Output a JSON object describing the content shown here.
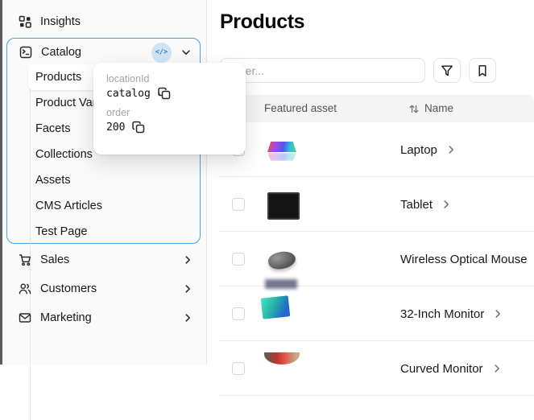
{
  "colors": {
    "accent_blue": "#4aa0e2",
    "badge_bg": "#cfe4f7",
    "badge_fg": "#2e77b6",
    "table_header_bg": "#f4f4f5"
  },
  "sidebar": {
    "insights": {
      "label": "Insights",
      "icon": "dashboard-icon"
    },
    "catalog": {
      "label": "Catalog",
      "icon": "terminal-square-icon",
      "badge_icon": "code-icon",
      "badge_text": "</>",
      "children": [
        "Products",
        "Product Variants",
        "Facets",
        "Collections",
        "Assets",
        "CMS Articles",
        "Test Page"
      ],
      "active_child": "Products"
    },
    "sales": {
      "label": "Sales",
      "icon": "cart-icon"
    },
    "customers": {
      "label": "Customers",
      "icon": "users-icon"
    },
    "marketing": {
      "label": "Marketing",
      "icon": "mail-icon"
    }
  },
  "tooltip": {
    "fields": [
      {
        "label": "locationId",
        "value": "catalog",
        "action_icon": "copy-icon"
      },
      {
        "label": "order",
        "value": "200",
        "action_icon": "copy-icon"
      }
    ]
  },
  "main": {
    "title": "Products",
    "search_placeholder": "Filter...",
    "toolbar_icons": [
      "funnel-icon",
      "bookmark-icon"
    ],
    "table": {
      "columns": [
        "Featured asset",
        "Name"
      ],
      "sort_icon": "arrow-up-down-icon",
      "rows": [
        {
          "name": "Laptop"
        },
        {
          "name": "Tablet"
        },
        {
          "name": "Wireless Optical Mouse"
        },
        {
          "name": "32-Inch Monitor"
        },
        {
          "name": "Curved Monitor"
        }
      ]
    }
  }
}
